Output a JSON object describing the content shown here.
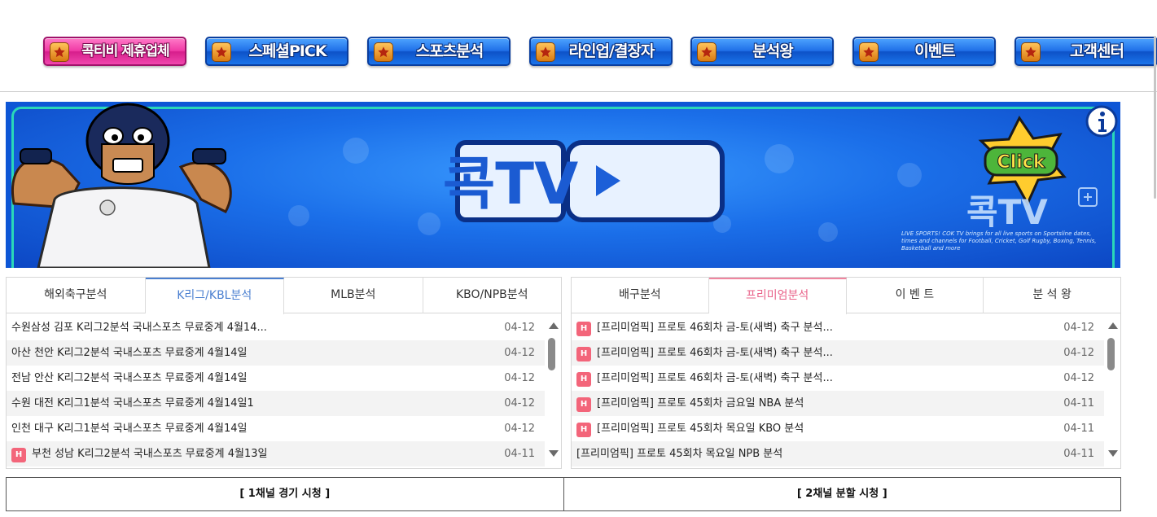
{
  "nav": {
    "items": [
      {
        "label": "콕티비 제휴업체",
        "color": "#e7299a"
      },
      {
        "label": "스페셜PICK",
        "color": "#1b6de8"
      },
      {
        "label": "스포츠분석",
        "color": "#1b6de8"
      },
      {
        "label": "라인업/결장자",
        "color": "#1b6de8"
      },
      {
        "label": "분석왕",
        "color": "#1b6de8"
      },
      {
        "label": "이벤트",
        "color": "#1b6de8"
      },
      {
        "label": "고객센터",
        "color": "#1b6de8"
      }
    ]
  },
  "banner": {
    "logo_text": "콕TV",
    "click_text": "Click",
    "small_logo_text": "콕TV",
    "caption": "LIVE SPORTS! COK TV brings for all live sports on Sportsline dates, times and channels for Football, Cricket, Golf Rugby, Boxing, Tennis, Basketball and more"
  },
  "left_panel": {
    "tabs": [
      {
        "label": "해외축구분석",
        "active": false
      },
      {
        "label": "K리그/KBL분석",
        "active": true
      },
      {
        "label": "MLB분석",
        "active": false
      },
      {
        "label": "KBO/NPB분석",
        "active": false
      }
    ],
    "rows": [
      {
        "title": "수원삼성 김포 K리그2분석 국내스포츠 무료중계 4월14...",
        "date": "04-12",
        "badge": ""
      },
      {
        "title": "아산 천안 K리그2분석 국내스포츠 무료중계 4월14일",
        "date": "04-12",
        "badge": ""
      },
      {
        "title": "전남 안산 K리그2분석 국내스포츠 무료중계 4월14일",
        "date": "04-12",
        "badge": ""
      },
      {
        "title": "수원 대전 K리그1분석 국내스포츠 무료중계 4월14일1",
        "date": "04-12",
        "badge": ""
      },
      {
        "title": "인천 대구 K리그1분석 국내스포츠 무료중계 4월14일",
        "date": "04-12",
        "badge": ""
      },
      {
        "title": "부천 성남 K리그2분석 국내스포츠 무료중계 4월13일",
        "date": "04-11",
        "badge": "H"
      }
    ]
  },
  "right_panel": {
    "tabs": [
      {
        "label": "배구분석",
        "active": false
      },
      {
        "label": "프리미엄분석",
        "active": true
      },
      {
        "label": "이 벤 트",
        "active": false
      },
      {
        "label": "분 석 왕",
        "active": false
      }
    ],
    "rows": [
      {
        "title": "[프리미엄픽] 프로토 46회차 금-토(새벽) 축구 분석...",
        "date": "04-12",
        "badge": "H"
      },
      {
        "title": "[프리미엄픽] 프로토 46회차 금-토(새벽) 축구 분석...",
        "date": "04-12",
        "badge": "H"
      },
      {
        "title": "[프리미엄픽] 프로토 46회차 금-토(새벽) 축구 분석...",
        "date": "04-12",
        "badge": "H"
      },
      {
        "title": "[프리미엄픽] 프로토 45회차 금요일 NBA 분석",
        "date": "04-11",
        "badge": "H"
      },
      {
        "title": "[프리미엄픽] 프로토 45회차 목요일 KBO 분석",
        "date": "04-11",
        "badge": "H"
      },
      {
        "title": "[프리미엄픽] 프로토 45회차 목요일 NPB 분석",
        "date": "04-11",
        "badge": ""
      }
    ]
  },
  "bottom": {
    "channel1": "[ 1채널 경기 시청 ]",
    "channel2": "[ 2채널 분할 시청 ]"
  }
}
